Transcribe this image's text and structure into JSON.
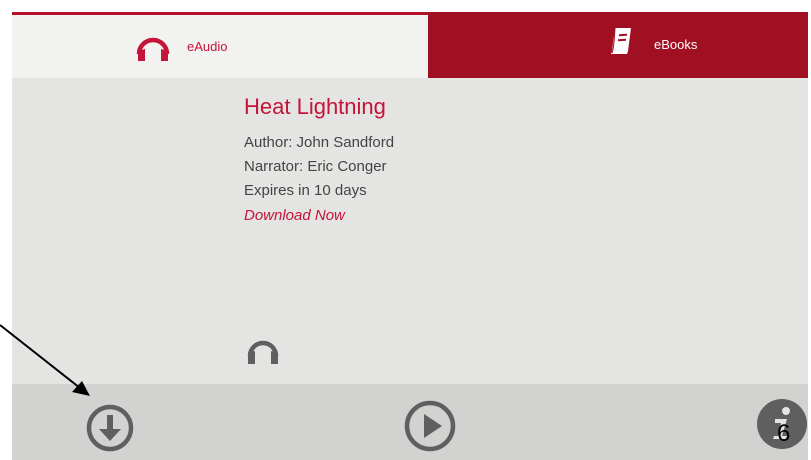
{
  "tabs": [
    {
      "label": "eAudio",
      "icon": "headphones-icon",
      "selected": true
    },
    {
      "label": "eBooks",
      "icon": "book-icon",
      "selected": false
    }
  ],
  "title": "Heat Lightning",
  "meta": {
    "author": "Author: John Sandford",
    "narrator": "Narrator: Eric Conger",
    "expires": "Expires in 10 days"
  },
  "download_link": "Download Now",
  "format_icon": "headphones-icon",
  "bottom_bar": {
    "download_icon": "download-icon",
    "play_icon": "play-icon",
    "info_icon": "info-icon"
  },
  "slide_number": "6",
  "colors": {
    "accent": "#c4143a",
    "tab_active_bg": "#f2f2f0",
    "tab_inactive_bg": "#a10f22",
    "icon_gray": "#5f5f5f",
    "screen_bg": "#e4e4e2",
    "bottom_bar_bg": "#d2d2d0"
  }
}
